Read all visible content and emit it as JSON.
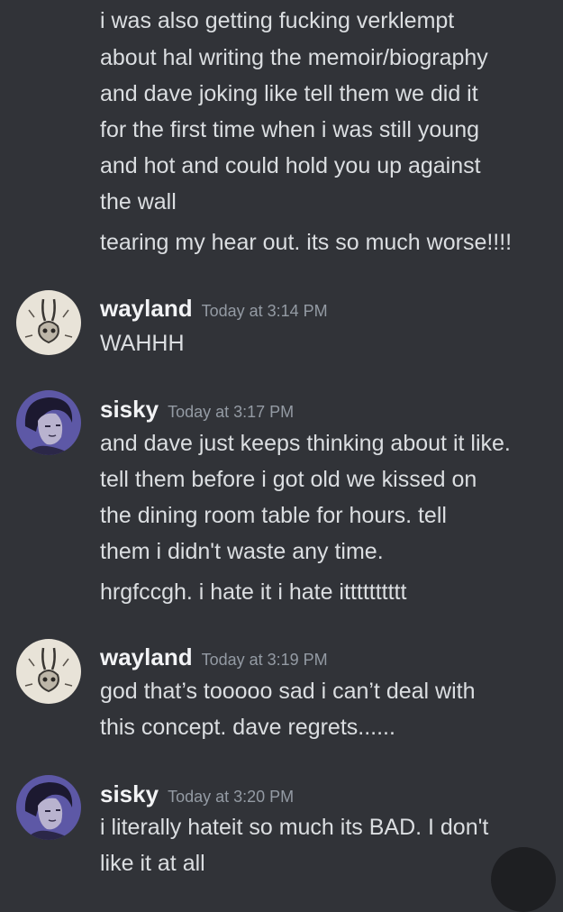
{
  "messages": [
    {
      "username": null,
      "continuation": true,
      "lines": [
        "i was also getting fucking verklempt",
        "about hal writing the memoir/biography",
        "and dave joking like tell them we did it",
        "for the first time when i was still young",
        "and hot and could hold you up against",
        "the wall",
        "tearing my hear out. its so much worse!!!!"
      ]
    },
    {
      "username": "wayland",
      "timestamp": "Today at 3:14 PM",
      "avatar": "rabbit-sketch-avatar",
      "lines": [
        "WAHHH"
      ]
    },
    {
      "username": "sisky",
      "timestamp": "Today at 3:17 PM",
      "avatar": "dark-haired-portrait-avatar",
      "lines": [
        "and dave just keeps thinking about it like.",
        "tell them before i got old we kissed on",
        "the dining room table for hours. tell",
        "them i didn't waste any time.",
        "hrgfccgh. i hate it i hate itttttttttt"
      ]
    },
    {
      "username": "wayland",
      "timestamp": "Today at 3:19 PM",
      "avatar": "rabbit-sketch-avatar",
      "lines": [
        "god that’s tooooo sad i can’t deal with",
        "this concept. dave regrets......"
      ]
    },
    {
      "username": "sisky",
      "timestamp": "Today at 3:20 PM",
      "avatar": "dark-haired-portrait-avatar",
      "lines": [
        "i literally hateit so much its BAD. I don't",
        "like it at all"
      ]
    }
  ],
  "colors": {
    "background": "#313338",
    "text": "#dbdee1",
    "username": "#f2f3f5",
    "timestamp": "#949ba4"
  }
}
